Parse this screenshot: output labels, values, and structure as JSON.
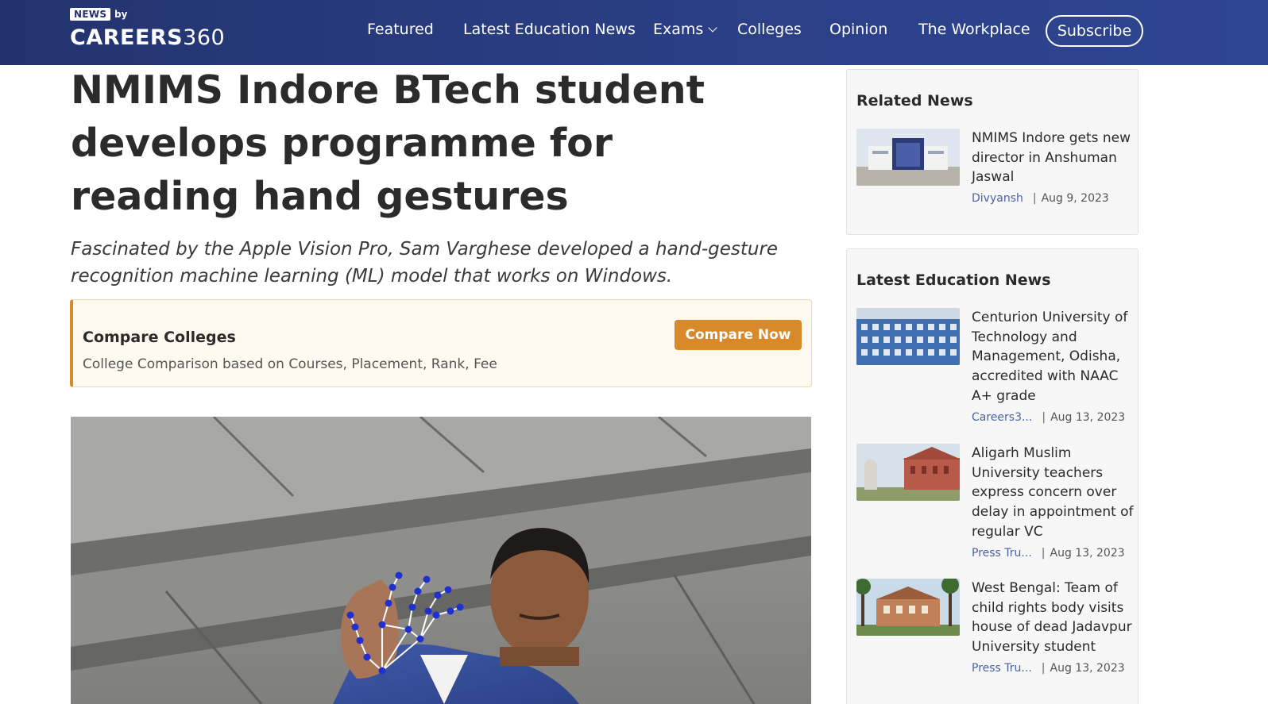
{
  "header": {
    "logo": {
      "badge": "NEWS",
      "by": "by",
      "brand_main": "CAREERS",
      "brand_num": "360"
    },
    "nav": [
      {
        "label": "Featured"
      },
      {
        "label": "Latest Education News"
      },
      {
        "label": "Exams",
        "has_dropdown": true
      },
      {
        "label": "Colleges"
      },
      {
        "label": "Opinion"
      },
      {
        "label": "The Workplace"
      }
    ],
    "subscribe_label": "Subscribe"
  },
  "article": {
    "title": "NMIMS Indore BTech student develops programme for reading hand gestures",
    "subtitle": "Fascinated by the Apple Vision Pro, Sam Varghese developed a hand-gesture recognition machine learning (ML) model that works on Windows."
  },
  "compare": {
    "title": "Compare Colleges",
    "description": "College Comparison based on Courses, Placement, Rank, Fee",
    "button_label": "Compare Now"
  },
  "related_news": {
    "heading": "Related News",
    "items": [
      {
        "title": "NMIMS Indore gets new director in Anshuman Jaswal",
        "author": "Divyansh",
        "date": "Aug 9, 2023"
      }
    ]
  },
  "latest_news": {
    "heading": "Latest Education News",
    "items": [
      {
        "title": "Centurion University of Technology and Management, Odisha, accredited with NAAC A+ grade",
        "author": "Careers3...",
        "date": "Aug 13, 2023"
      },
      {
        "title": "Aligarh Muslim University teachers express concern over delay in appointment of regular VC",
        "author": "Press Tru...",
        "date": "Aug 13, 2023"
      },
      {
        "title": "West Bengal: Team of child rights body visits house of dead Jadavpur University student",
        "author": "Press Tru...",
        "date": "Aug 13, 2023"
      }
    ]
  },
  "colors": {
    "header_bg": "#2b3f86",
    "accent_orange": "#d8892a",
    "author_link": "#4a62a8"
  }
}
